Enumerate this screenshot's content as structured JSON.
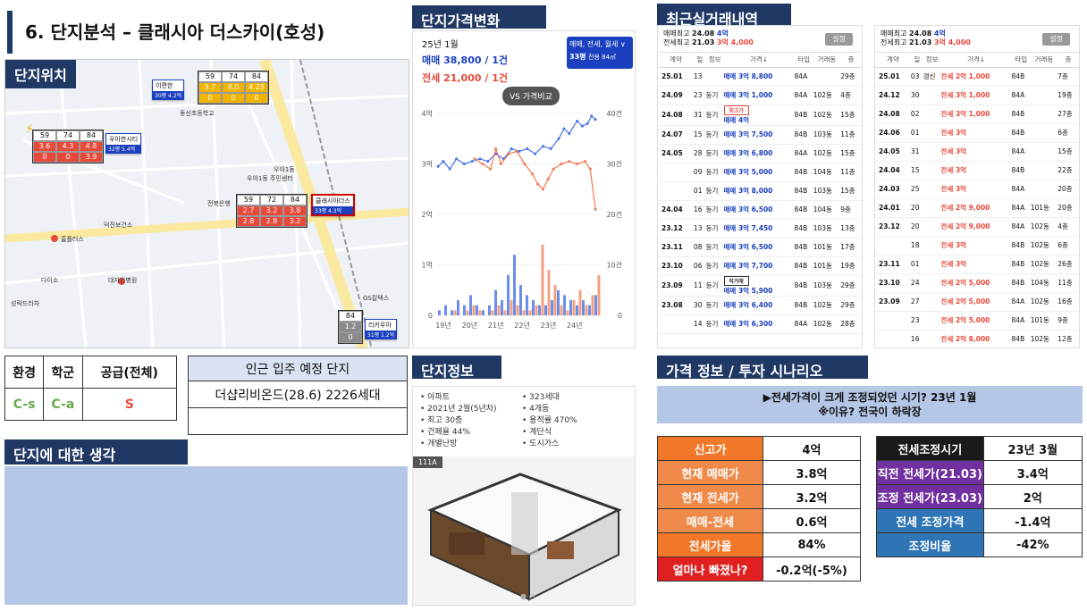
{
  "title": "6. 단지분석 – 클래시아 더스카이(호성)",
  "sections": {
    "location": "단지위치",
    "price_change": "단지가격변화",
    "recent_deals": "최근실거래내역",
    "complex_info": "단지정보",
    "scenario": "가격 정보 / 투자 시나리오",
    "thoughts": "단지에 대한 생각"
  },
  "map": {
    "labels": [
      "이편한",
      "30평 4.2억",
      "우아한시티",
      "32평 5.4억",
      "클래시아더스",
      "33평 4.3억",
      "리키우아",
      "31평 1.2억",
      "동신초등학교",
      "우아1동 주민센터",
      "우아1동",
      "덕진보건소",
      "홈플러스",
      "다이소",
      "대자인병원",
      "성락드라차",
      "전북은행",
      "GS칼텍스"
    ],
    "box_yellow": {
      "head": [
        "59",
        "74",
        "84"
      ],
      "row1": [
        "3.7",
        "4.0",
        "4.25"
      ],
      "row2": [
        "0",
        "0",
        "0"
      ]
    },
    "box_left": {
      "head": [
        "59",
        "74",
        "84"
      ],
      "row1": [
        "3.6",
        "4.3",
        "4.8"
      ],
      "row2": [
        "0",
        "0",
        "3.9"
      ]
    },
    "box_main": {
      "head": [
        "59",
        "72",
        "84"
      ],
      "row1": [
        "2.7",
        "3.2",
        "3.8"
      ],
      "row2": [
        "2.8",
        "2.8",
        "3.2"
      ]
    },
    "box_gray": {
      "head": [
        "84"
      ],
      "row1": [
        "1.2"
      ],
      "row2": [
        "0"
      ]
    }
  },
  "grades": {
    "headers": [
      "환경",
      "학군",
      "공급(전체)"
    ],
    "values": [
      "C-s",
      "C-a",
      "S"
    ]
  },
  "nearby": {
    "header": "인근 입주 예정 단지",
    "rows": [
      "더샵리비온드(28.6) 2226세대",
      ""
    ]
  },
  "price": {
    "month": "25년 1월",
    "sale": "매매 38,800 / 1건",
    "jeonse": "전세 21,000 / 1건",
    "filter": "매매, 전세, 월세 ∨",
    "size": "33평",
    "size_sub": "전용 84㎡",
    "compare": "VS 가격비교"
  },
  "chart_data": {
    "type": "line",
    "x": [
      "19년",
      "20년",
      "21년",
      "22년",
      "23년",
      "24년"
    ],
    "left_ticks": [
      "4억",
      "3억",
      "2억",
      "1억",
      "0"
    ],
    "right_ticks": [
      "40건",
      "30건",
      "20건",
      "10건",
      "0"
    ],
    "ylim": [
      0,
      4
    ],
    "series": [
      {
        "name": "매매",
        "color": "#4472e8",
        "values": [
          [
            2019.0,
            2.95
          ],
          [
            2019.2,
            3.05
          ],
          [
            2019.45,
            2.9
          ],
          [
            2019.7,
            3.1
          ],
          [
            2020.0,
            3.0
          ],
          [
            2020.3,
            3.05
          ],
          [
            2020.6,
            3.1
          ],
          [
            2020.9,
            3.05
          ],
          [
            2021.2,
            3.2
          ],
          [
            2021.5,
            3.1
          ],
          [
            2021.8,
            3.3
          ],
          [
            2022.1,
            3.25
          ],
          [
            2022.4,
            3.3
          ],
          [
            2022.7,
            3.2
          ],
          [
            2023.0,
            3.35
          ],
          [
            2023.3,
            3.3
          ],
          [
            2023.6,
            3.5
          ],
          [
            2023.8,
            3.7
          ],
          [
            2024.0,
            3.6
          ],
          [
            2024.3,
            3.85
          ],
          [
            2024.5,
            3.75
          ],
          [
            2024.7,
            3.8
          ],
          [
            2024.85,
            3.95
          ],
          [
            2025.0,
            3.88
          ]
        ]
      },
      {
        "name": "전세",
        "color": "#f07850",
        "values": [
          [
            2020.4,
            3.1
          ],
          [
            2020.7,
            3.0
          ],
          [
            2021.0,
            2.9
          ],
          [
            2021.2,
            3.3
          ],
          [
            2021.4,
            3.0
          ],
          [
            2021.7,
            3.2
          ],
          [
            2022.0,
            3.25
          ],
          [
            2022.3,
            3.0
          ],
          [
            2022.6,
            2.8
          ],
          [
            2022.8,
            2.6
          ],
          [
            2023.0,
            2.5
          ],
          [
            2023.2,
            2.7
          ],
          [
            2023.4,
            2.9
          ],
          [
            2023.7,
            3.0
          ],
          [
            2024.0,
            3.05
          ],
          [
            2024.3,
            3.0
          ],
          [
            2024.6,
            3.05
          ],
          [
            2024.8,
            2.9
          ],
          [
            2025.0,
            2.1
          ]
        ]
      }
    ],
    "volume": {
      "sale": [
        1,
        2,
        1,
        3,
        2,
        4,
        2,
        1,
        2,
        5,
        3,
        8,
        12,
        6,
        4,
        3,
        2,
        2,
        3,
        5,
        4,
        3,
        2,
        3,
        2,
        4
      ],
      "jeonse": [
        0,
        0,
        1,
        0,
        1,
        2,
        1,
        0,
        1,
        2,
        1,
        3,
        2,
        1,
        1,
        2,
        14,
        9,
        6,
        2,
        1,
        3,
        5,
        2,
        4,
        8
      ]
    }
  },
  "deals_left": {
    "summary1_label": "매매최고",
    "summary1_date": "24.08",
    "summary1_price": "4억",
    "summary2_label": "전세최고",
    "summary2_date": "21.03",
    "summary2_price": "3억 4,000",
    "btn": "설정",
    "headers": [
      "계약",
      "일",
      "정보",
      "가격↓",
      "타입",
      "거래동",
      "층"
    ],
    "rows": [
      [
        "25.01",
        "13",
        "",
        "",
        "84A",
        "",
        "29층"
      ],
      [
        "24.09",
        "23",
        "등기",
        "매매 3억 1,000",
        "84A",
        "102동",
        "4층"
      ],
      [
        "24.08",
        "31",
        "등기",
        "매매 4억",
        "84B",
        "102동",
        "15층"
      ],
      [
        "24.07",
        "15",
        "등기",
        "매매 3억 7,500",
        "84B",
        "103동",
        "11층"
      ],
      [
        "24.05",
        "28",
        "등기",
        "매매 3억 6,800",
        "84A",
        "102동",
        "15층"
      ],
      [
        "",
        "09",
        "등기",
        "매매 3억 5,000",
        "84B",
        "104동",
        "11층"
      ],
      [
        "",
        "01",
        "등기",
        "매매 3억 8,000",
        "84B",
        "103동",
        "15층"
      ],
      [
        "24.04",
        "16",
        "등기",
        "매매 3억 6,500",
        "84B",
        "104동",
        "9층"
      ],
      [
        "23.12",
        "13",
        "등기",
        "매매 3억 7,450",
        "84B",
        "103동",
        "13층"
      ],
      [
        "23.11",
        "08",
        "등기",
        "매매 3억 6,500",
        "84B",
        "101동",
        "17층"
      ],
      [
        "23.10",
        "06",
        "등기",
        "매매 3억 7,700",
        "84B",
        "101동",
        "19층"
      ],
      [
        "23.09",
        "11",
        "등기",
        "매매 3억 5,900",
        "84B",
        "103동",
        "29층"
      ],
      [
        "23.08",
        "30",
        "등기",
        "매매 3억 6,400",
        "84B",
        "102동",
        "29층"
      ],
      [
        "",
        "14",
        "등기",
        "매매 3억 6,300",
        "84A",
        "102동",
        "28층"
      ]
    ],
    "first_row_price": "매매 3억 8,800",
    "tag_highest": "최고가",
    "tag_direct": "직거래"
  },
  "deals_right": {
    "summary1_label": "매매최고",
    "summary1_date": "24.08",
    "summary1_price": "4억",
    "summary2_label": "전세최고",
    "summary2_date": "21.03",
    "summary2_price": "3억 4,000",
    "btn": "설정",
    "headers": [
      "계약",
      "일",
      "정보",
      "가격↓",
      "타입",
      "거래동",
      "층"
    ],
    "rows": [
      [
        "25.01",
        "03",
        "갱신",
        "전세 2억 1,000",
        "84B",
        "",
        "7층"
      ],
      [
        "24.12",
        "30",
        "",
        "전세 3억 1,000",
        "84A",
        "",
        "19층"
      ],
      [
        "24.08",
        "02",
        "",
        "전세 3억 1,000",
        "84B",
        "",
        "27층"
      ],
      [
        "24.06",
        "01",
        "",
        "전세 3억",
        "84B",
        "",
        "6층"
      ],
      [
        "24.05",
        "31",
        "",
        "전세 3억",
        "84A",
        "",
        "15층"
      ],
      [
        "24.04",
        "15",
        "",
        "전세 3억",
        "84B",
        "",
        "22층"
      ],
      [
        "24.03",
        "25",
        "",
        "전세 3억",
        "84A",
        "",
        "20층"
      ],
      [
        "24.01",
        "20",
        "",
        "전세 2억 9,000",
        "84A",
        "101동",
        "20층"
      ],
      [
        "23.12",
        "20",
        "",
        "전세 2억 9,000",
        "84A",
        "102동",
        "4층"
      ],
      [
        "",
        "18",
        "",
        "전세 3억",
        "84B",
        "102동",
        "6층"
      ],
      [
        "23.11",
        "01",
        "",
        "전세 3억",
        "84B",
        "102동",
        "26층"
      ],
      [
        "23.10",
        "24",
        "",
        "전세 2억 5,000",
        "84B",
        "104동",
        "11층"
      ],
      [
        "23.09",
        "27",
        "",
        "전세 2억 5,000",
        "84A",
        "102동",
        "16층"
      ],
      [
        "",
        "23",
        "",
        "전세 2억 5,000",
        "84A",
        "101동",
        "9층"
      ],
      [
        "",
        "16",
        "",
        "전세 2억 8,000",
        "84B",
        "102동",
        "12층"
      ]
    ]
  },
  "info": {
    "left": [
      "아파트",
      "2021년 2월(5년차)",
      "최고 30층",
      "건폐율 44%",
      "개별난방"
    ],
    "right": [
      "323세대",
      "4개동",
      "용적률 470%",
      "계단식",
      "도시가스"
    ],
    "plan_label": "111A"
  },
  "scenario": {
    "banner1": "▶전세가격이 크게 조정되었던 시기? 23년 1월",
    "banner2": "※이유? 전국이 하락장",
    "left": [
      {
        "k": "신고가",
        "v": "4억"
      },
      {
        "k": "현재 매매가",
        "v": "3.8억"
      },
      {
        "k": "현재 전세가",
        "v": "3.2억"
      },
      {
        "k": "매매-전세",
        "v": "0.6억"
      },
      {
        "k": "전세가율",
        "v": "84%"
      },
      {
        "k": "얼마나 빠졌나?",
        "v": "-0.2억(-5%)"
      }
    ],
    "right": [
      {
        "k": "전세조정시기",
        "v": "23년 3월"
      },
      {
        "k": "직전 전세가(21.03)",
        "v": "3.4억"
      },
      {
        "k": "조정 전세가(23.03)",
        "v": "2억"
      },
      {
        "k": "전세 조정가격",
        "v": "-1.4억"
      },
      {
        "k": "조정비율",
        "v": "-42%"
      }
    ]
  }
}
